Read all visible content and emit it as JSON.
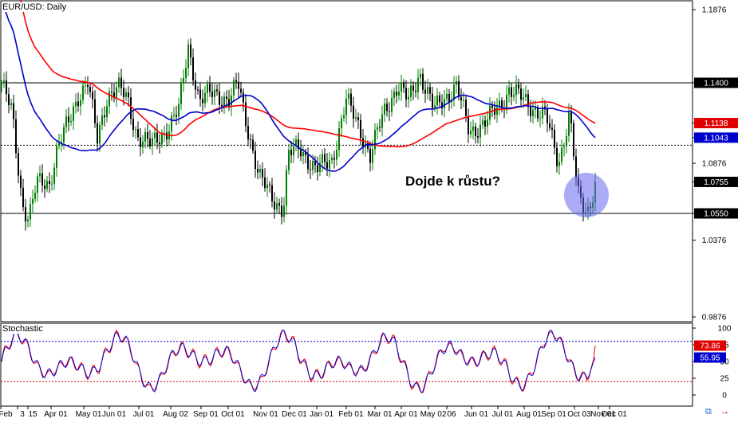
{
  "chart_data": [
    {
      "type": "candlestick",
      "title": "EUR/USD: Daily",
      "y_axis": {
        "tick_labels": [
          "1.1876",
          "1.1400",
          "1.1138",
          "1.1043",
          "1.0876",
          "1.0755",
          "1.0550",
          "1.0376",
          "0.9876"
        ],
        "ylim": [
          0.986,
          1.194
        ]
      },
      "x_axis": {
        "tick_labels": [
          "Feb",
          "3",
          "15",
          "Apr 01",
          "May 01",
          "Jun 01",
          "Jul 01",
          "Aug 02",
          "Sep 01",
          "Oct 01",
          "Nov 01",
          "Dec 01",
          "Jan 01",
          "Feb 01",
          "Mar 01",
          "Apr 01",
          "May 02",
          "06",
          "Jun 01",
          "Jul 01",
          "Aug 01",
          "Sep 01",
          "Oct 03",
          "Nov 01",
          "Dec 01"
        ]
      },
      "horizontal_levels": [
        {
          "value": 1.14,
          "style": "solid",
          "label": "1.1400"
        },
        {
          "value": 1.0994,
          "style": "dotted"
        },
        {
          "value": 1.055,
          "style": "solid",
          "label": "1.0550"
        }
      ],
      "price_labels": [
        {
          "value": 1.14,
          "label": "1.1400",
          "bg": "#000000"
        },
        {
          "value": 1.1138,
          "label": "1.1138",
          "bg": "#e00000"
        },
        {
          "value": 1.1043,
          "label": "1.1043",
          "bg": "#0000cc"
        },
        {
          "value": 1.0755,
          "label": "1.0755",
          "bg": "#000000"
        },
        {
          "value": 1.055,
          "label": "1.0550",
          "bg": "#000000"
        }
      ],
      "series": [
        {
          "kind": "moving-average",
          "color": "#ff0000",
          "end_value": 1.1138
        },
        {
          "kind": "moving-average",
          "color": "#0000cc",
          "end_value": 1.1043
        },
        {
          "kind": "candles",
          "bull_color": "#008000",
          "bear_color": "#000000",
          "last_close": 1.0755
        }
      ],
      "annotations": [
        {
          "text": "Dojde k růstu?"
        }
      ],
      "highlight": {
        "shape": "circle",
        "color": "#6666ee"
      }
    },
    {
      "type": "line",
      "title": "Stochastic",
      "y_axis": {
        "tick_labels": [
          "100",
          "75",
          "50",
          "25",
          "0"
        ],
        "ylim": [
          0,
          100
        ]
      },
      "levels": [
        {
          "value": 80,
          "color": "#0000cc",
          "style": "dotted"
        },
        {
          "value": 20,
          "color": "#cc0000",
          "style": "dotted"
        }
      ],
      "value_labels": [
        {
          "label": "73.86",
          "bg": "#e00000"
        },
        {
          "label": "55.95",
          "bg": "#0000cc"
        }
      ],
      "series": [
        {
          "kind": "main",
          "color": "#0000cc",
          "last_value": 55.95
        },
        {
          "kind": "signal",
          "color": "#ff0000",
          "last_value": 73.86
        }
      ]
    }
  ],
  "colors": {
    "axis": "#000000",
    "bull": "#008000",
    "bear": "#000000",
    "ma_red": "#ff0000",
    "ma_blue": "#0000cc",
    "highlight": "#6666ee"
  },
  "footer_icons": [
    "link-icon",
    "arrow-icon"
  ]
}
